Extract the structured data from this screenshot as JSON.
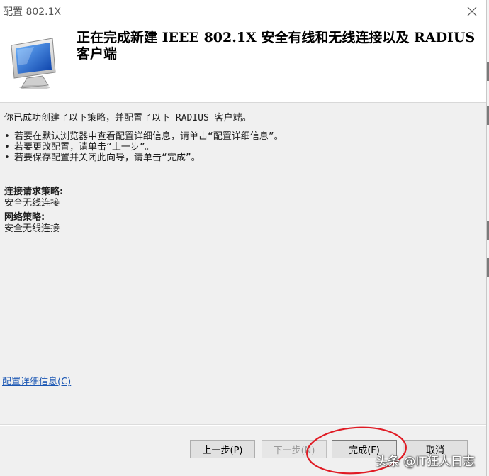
{
  "window": {
    "title": "配置 802.1X"
  },
  "header": {
    "title": "正在完成新建 IEEE 802.1X 安全有线和无线连接以及 RADIUS 客户端",
    "icon": "computer-monitor-icon"
  },
  "content": {
    "intro": "你已成功创建了以下策略，并配置了以下 RADIUS 客户端。",
    "bullets": [
      "若要在默认浏览器中查看配置详细信息，请单击“配置详细信息”。",
      "若要更改配置，请单击“上一步”。",
      "若要保存配置并关闭此向导，请单击“完成”。"
    ],
    "connection_policy_label": "连接请求策略:",
    "connection_policy_value": "安全无线连接",
    "network_policy_label": "网络策略:",
    "network_policy_value": "安全无线连接",
    "details_link": "配置详细信息(C)"
  },
  "buttons": {
    "back": "上一步(P)",
    "next": "下一步(N)",
    "finish": "完成(F)",
    "cancel": "取消"
  },
  "watermark": "头条 @IT狂人日志",
  "colors": {
    "link": "#1a56b3",
    "annotation": "#e01b24"
  }
}
